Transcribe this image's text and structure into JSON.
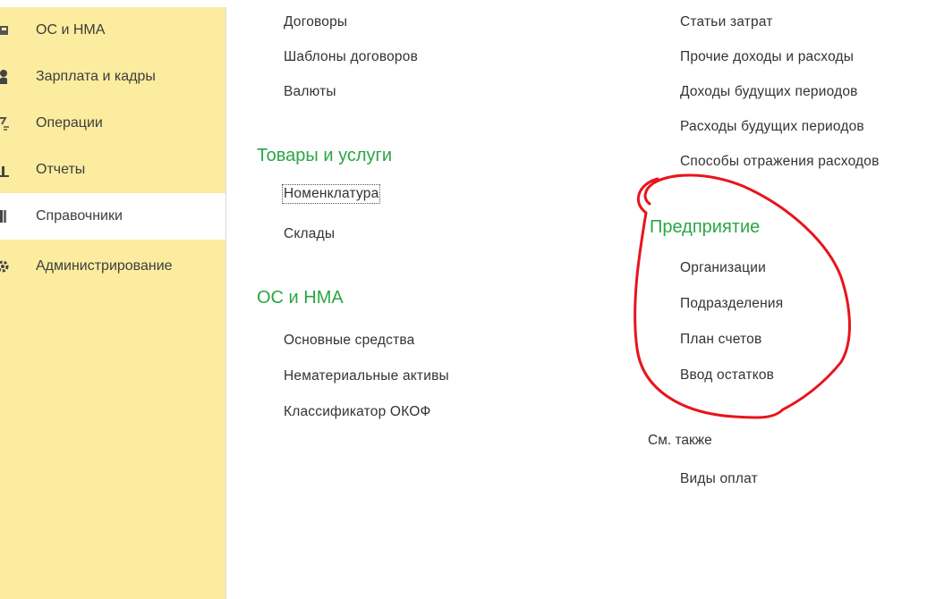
{
  "sidebar": {
    "items": [
      {
        "label": "ОС и НМА",
        "icon": "asset-icon"
      },
      {
        "label": "Зарплата и кадры",
        "icon": "person-icon"
      },
      {
        "label": "Операции",
        "icon": "operations-icon"
      },
      {
        "label": "Отчеты",
        "icon": "chart-icon"
      },
      {
        "label": "Справочники",
        "icon": "catalog-icon",
        "active": true
      },
      {
        "label": "Администрирование",
        "icon": "gear-icon"
      }
    ]
  },
  "col1": {
    "top_links": [
      "Договоры",
      "Шаблоны договоров",
      "Валюты"
    ],
    "groups": [
      {
        "title": "Товары и услуги",
        "links": [
          "Номенклатура",
          "Склады"
        ]
      },
      {
        "title": "ОС и НМА",
        "links": [
          "Основные средства",
          "Нематериальные активы",
          "Классификатор ОКОФ"
        ]
      }
    ]
  },
  "col2": {
    "top_links": [
      "Статьи затрат",
      "Прочие доходы и расходы",
      "Доходы будущих периодов",
      "Расходы будущих периодов",
      "Способы отражения расходов"
    ],
    "group": {
      "title": "Предприятие",
      "links": [
        "Организации",
        "Подразделения",
        "План счетов",
        "Ввод остатков"
      ]
    },
    "see_also": {
      "title": "См. также",
      "links": [
        "Виды оплат"
      ]
    }
  },
  "colors": {
    "sidebar_bg": "#fbec9f",
    "group_title": "#2aa644",
    "annotation": "#e8141c"
  }
}
